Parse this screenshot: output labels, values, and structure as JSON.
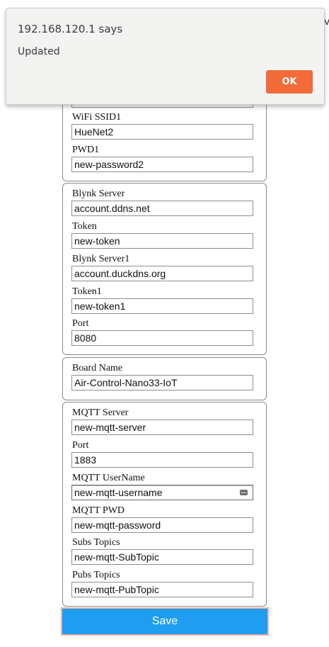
{
  "dialog": {
    "title": "192.168.120.1 says",
    "message": "Updated",
    "ok_label": "OK"
  },
  "edge_glyph": "V",
  "wifi": {
    "ssid1_label": "WiFi SSID1",
    "ssid1_value": "HueNet2",
    "pwd1_label": "PWD1",
    "pwd1_value": "new-password2"
  },
  "blynk": {
    "server_label": "Blynk Server",
    "server_value": "account.ddns.net",
    "token_label": "Token",
    "token_value": "new-token",
    "server1_label": "Blynk Server1",
    "server1_value": "account.duckdns.org",
    "token1_label": "Token1",
    "token1_value": "new-token1",
    "port_label": "Port",
    "port_value": "8080"
  },
  "board": {
    "name_label": "Board Name",
    "name_value": "Air-Control-Nano33-IoT"
  },
  "mqtt": {
    "server_label": "MQTT Server",
    "server_value": "new-mqtt-server",
    "port_label": "Port",
    "port_value": "1883",
    "username_label": "MQTT UserName",
    "username_value": "new-mqtt-username",
    "pwd_label": "MQTT PWD",
    "pwd_value": "new-mqtt-password",
    "subs_label": "Subs Topics",
    "subs_value": "new-mqtt-SubTopic",
    "pubs_label": "Pubs Topics",
    "pubs_value": "new-mqtt-PubTopic"
  },
  "save_label": "Save",
  "colors": {
    "save_button": "#1e9df1",
    "ok_button": "#f26b38",
    "dialog_background": "#f3f3f2"
  }
}
